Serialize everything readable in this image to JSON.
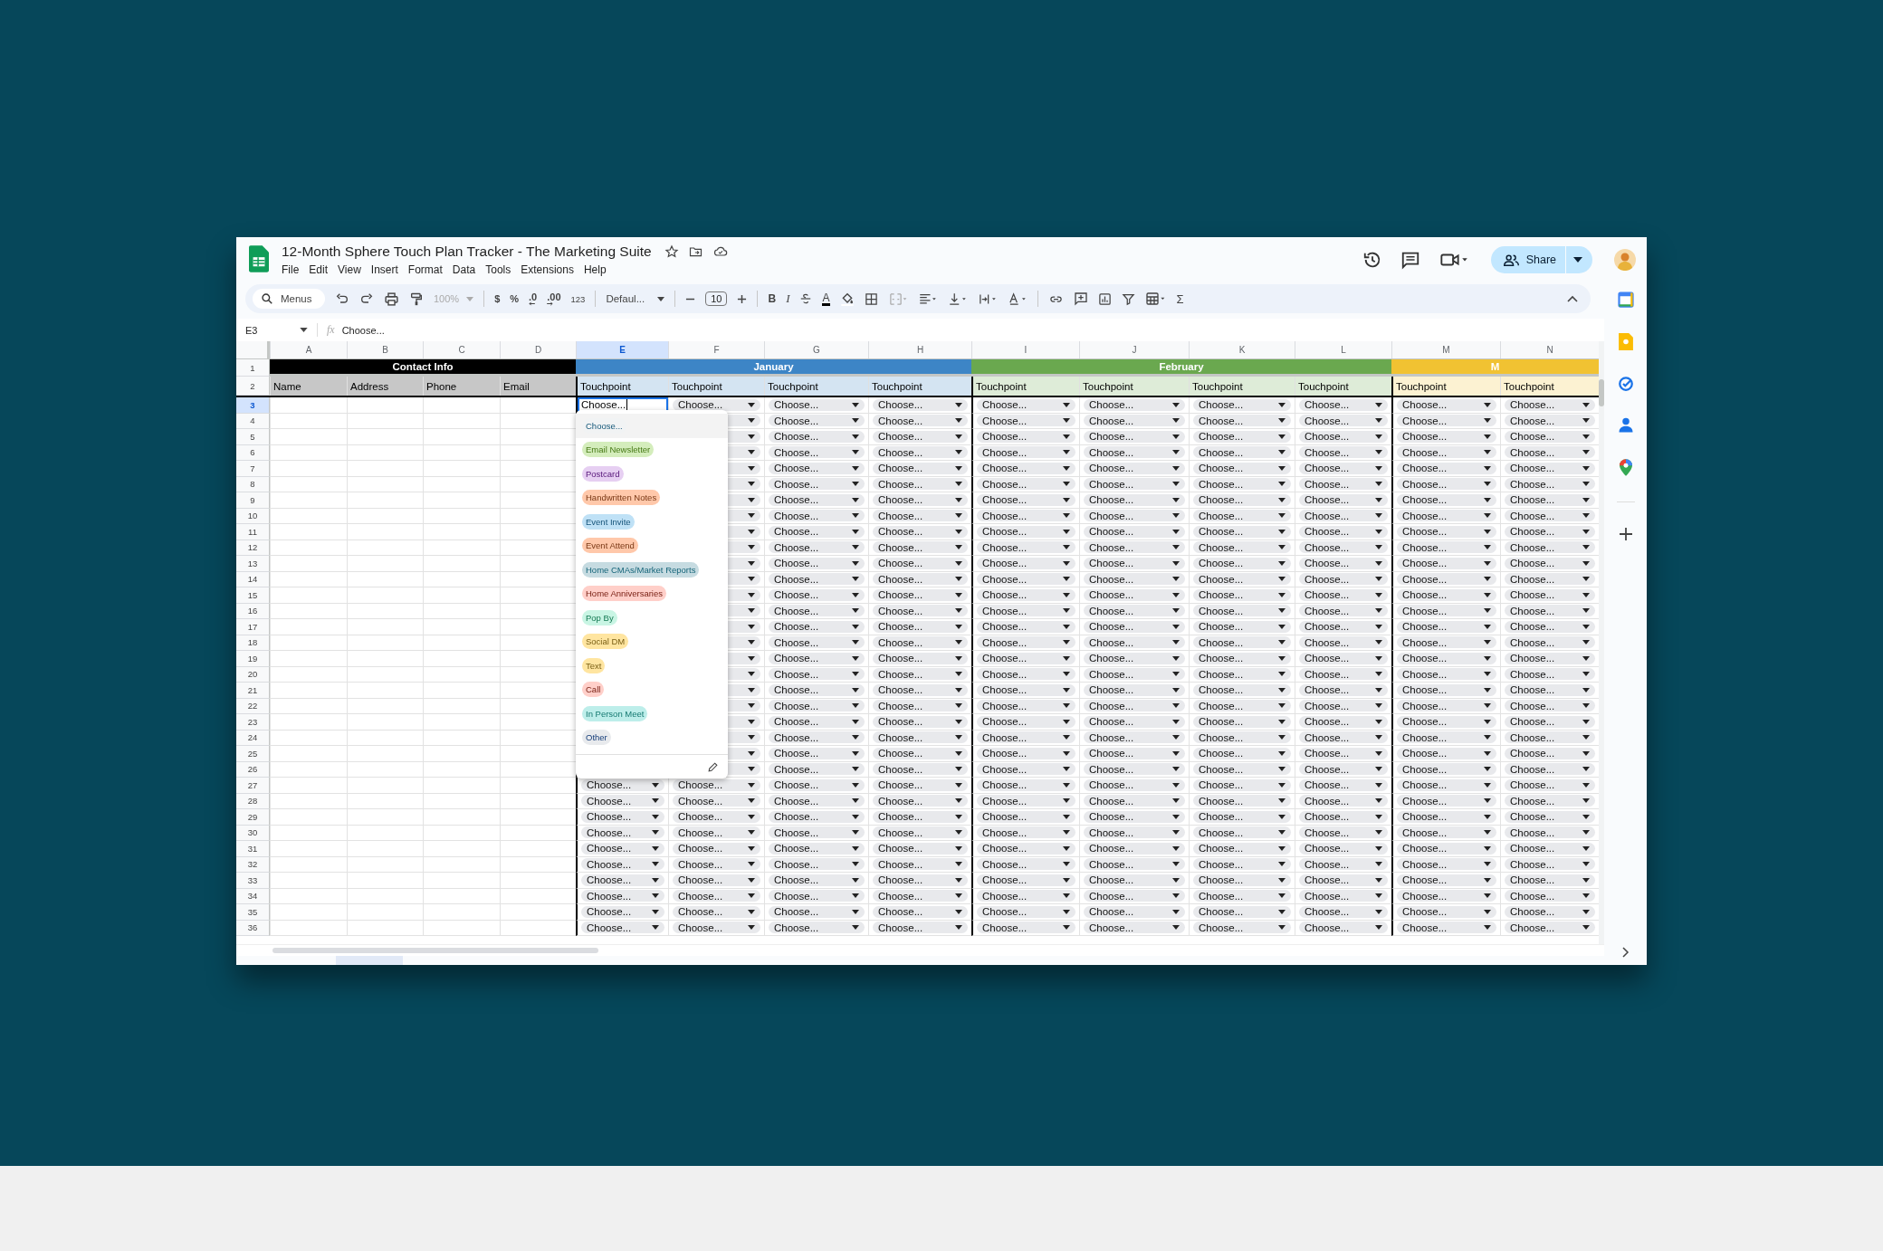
{
  "window": {
    "title": "12-Month Sphere Touch Plan Tracker - The Marketing Suite"
  },
  "menu_bar": [
    "File",
    "Edit",
    "View",
    "Insert",
    "Format",
    "Data",
    "Tools",
    "Extensions",
    "Help"
  ],
  "toolbar": {
    "search_placeholder": "Menus",
    "zoom": "100%",
    "currency": "$",
    "percent": "%",
    "decrease_decimals": ".0",
    "increase_decimals": ".00",
    "number_format": "123",
    "font": "Defaul...",
    "font_size": "10",
    "bold": "B",
    "italic": "I",
    "text_color": "A",
    "functions": "Σ"
  },
  "share_button": {
    "label": "Share"
  },
  "formula_bar": {
    "cell_ref": "E3",
    "fx": "fx",
    "value": "Choose..."
  },
  "columns": [
    {
      "letter": "A",
      "selected": false
    },
    {
      "letter": "B",
      "selected": false
    },
    {
      "letter": "C",
      "selected": false
    },
    {
      "letter": "D",
      "selected": false
    },
    {
      "letter": "E",
      "selected": true
    },
    {
      "letter": "F",
      "selected": false
    },
    {
      "letter": "G",
      "selected": false
    },
    {
      "letter": "H",
      "selected": false
    },
    {
      "letter": "I",
      "selected": false
    },
    {
      "letter": "J",
      "selected": false
    },
    {
      "letter": "K",
      "selected": false
    },
    {
      "letter": "L",
      "selected": false
    },
    {
      "letter": "M",
      "selected": false
    },
    {
      "letter": "N",
      "selected": false
    }
  ],
  "group_row": {
    "number": "1",
    "groups": [
      {
        "label": "Contact Info",
        "color": "#000000",
        "fields": [
          "Name",
          "Address",
          "Phone",
          "Email"
        ]
      },
      {
        "label": "January",
        "color": "#3d85c6",
        "fields": [
          "Touchpoint",
          "Touchpoint",
          "Touchpoint",
          "Touchpoint"
        ]
      },
      {
        "label": "February",
        "color": "#6aa84f",
        "fields": [
          "Touchpoint",
          "Touchpoint",
          "Touchpoint",
          "Touchpoint"
        ]
      },
      {
        "label": "M",
        "color": "#f1c232",
        "fields": [
          "Touchpoint",
          "Touchpoint"
        ]
      }
    ]
  },
  "field_row": {
    "number": "2"
  },
  "rows": [
    {
      "number": "3",
      "selected": true,
      "cells": [
        "Choose...",
        "Choose...",
        "Choose...",
        "Choose...",
        "Choose...",
        "Choose...",
        "Choose...",
        "Choose...",
        "Choose...",
        "Choose..."
      ]
    },
    {
      "number": "4",
      "selected": false,
      "cells": [
        null,
        null,
        "Choose...",
        "Choose...",
        "Choose...",
        "Choose...",
        "Choose...",
        "Choose...",
        "Choose...",
        "Choose..."
      ]
    },
    {
      "number": "5",
      "selected": false,
      "cells": [
        null,
        null,
        "Choose...",
        "Choose...",
        "Choose...",
        "Choose...",
        "Choose...",
        "Choose...",
        "Choose...",
        "Choose..."
      ]
    },
    {
      "number": "6",
      "selected": false,
      "cells": [
        null,
        null,
        "Choose...",
        "Choose...",
        "Choose...",
        "Choose...",
        "Choose...",
        "Choose...",
        "Choose...",
        "Choose..."
      ]
    },
    {
      "number": "7",
      "selected": false,
      "cells": [
        null,
        null,
        "Choose...",
        "Choose...",
        "Choose...",
        "Choose...",
        "Choose...",
        "Choose...",
        "Choose...",
        "Choose..."
      ]
    },
    {
      "number": "8",
      "selected": false,
      "cells": [
        null,
        null,
        "Choose...",
        "Choose...",
        "Choose...",
        "Choose...",
        "Choose...",
        "Choose...",
        "Choose...",
        "Choose..."
      ]
    },
    {
      "number": "9",
      "selected": false,
      "cells": [
        null,
        null,
        "Choose...",
        "Choose...",
        "Choose...",
        "Choose...",
        "Choose...",
        "Choose...",
        "Choose...",
        "Choose..."
      ]
    },
    {
      "number": "10",
      "selected": false,
      "cells": [
        null,
        null,
        "Choose...",
        "Choose...",
        "Choose...",
        "Choose...",
        "Choose...",
        "Choose...",
        "Choose...",
        "Choose..."
      ]
    },
    {
      "number": "11",
      "selected": false,
      "cells": [
        null,
        null,
        "Choose...",
        "Choose...",
        "Choose...",
        "Choose...",
        "Choose...",
        "Choose...",
        "Choose...",
        "Choose..."
      ]
    },
    {
      "number": "12",
      "selected": false,
      "cells": [
        null,
        null,
        "Choose...",
        "Choose...",
        "Choose...",
        "Choose...",
        "Choose...",
        "Choose...",
        "Choose...",
        "Choose..."
      ]
    },
    {
      "number": "13",
      "selected": false,
      "cells": [
        null,
        null,
        "Choose...",
        "Choose...",
        "Choose...",
        "Choose...",
        "Choose...",
        "Choose...",
        "Choose...",
        "Choose..."
      ]
    },
    {
      "number": "14",
      "selected": false,
      "cells": [
        null,
        null,
        "Choose...",
        "Choose...",
        "Choose...",
        "Choose...",
        "Choose...",
        "Choose...",
        "Choose...",
        "Choose..."
      ]
    },
    {
      "number": "15",
      "selected": false,
      "cells": [
        null,
        null,
        "Choose...",
        "Choose...",
        "Choose...",
        "Choose...",
        "Choose...",
        "Choose...",
        "Choose...",
        "Choose..."
      ]
    },
    {
      "number": "16",
      "selected": false,
      "cells": [
        null,
        null,
        "Choose...",
        "Choose...",
        "Choose...",
        "Choose...",
        "Choose...",
        "Choose...",
        "Choose...",
        "Choose..."
      ]
    },
    {
      "number": "17",
      "selected": false,
      "cells": [
        null,
        null,
        "Choose...",
        "Choose...",
        "Choose...",
        "Choose...",
        "Choose...",
        "Choose...",
        "Choose...",
        "Choose..."
      ]
    },
    {
      "number": "18",
      "selected": false,
      "cells": [
        null,
        null,
        "Choose...",
        "Choose...",
        "Choose...",
        "Choose...",
        "Choose...",
        "Choose...",
        "Choose...",
        "Choose..."
      ]
    },
    {
      "number": "19",
      "selected": false,
      "cells": [
        null,
        null,
        "Choose...",
        "Choose...",
        "Choose...",
        "Choose...",
        "Choose...",
        "Choose...",
        "Choose...",
        "Choose..."
      ]
    },
    {
      "number": "20",
      "selected": false,
      "cells": [
        null,
        null,
        "Choose...",
        "Choose...",
        "Choose...",
        "Choose...",
        "Choose...",
        "Choose...",
        "Choose...",
        "Choose..."
      ]
    },
    {
      "number": "21",
      "selected": false,
      "cells": [
        null,
        null,
        "Choose...",
        "Choose...",
        "Choose...",
        "Choose...",
        "Choose...",
        "Choose...",
        "Choose...",
        "Choose..."
      ]
    },
    {
      "number": "22",
      "selected": false,
      "cells": [
        null,
        null,
        "Choose...",
        "Choose...",
        "Choose...",
        "Choose...",
        "Choose...",
        "Choose...",
        "Choose...",
        "Choose..."
      ]
    },
    {
      "number": "23",
      "selected": false,
      "cells": [
        null,
        null,
        "Choose...",
        "Choose...",
        "Choose...",
        "Choose...",
        "Choose...",
        "Choose...",
        "Choose...",
        "Choose..."
      ]
    },
    {
      "number": "24",
      "selected": false,
      "cells": [
        null,
        null,
        "Choose...",
        "Choose...",
        "Choose...",
        "Choose...",
        "Choose...",
        "Choose...",
        "Choose...",
        "Choose..."
      ]
    },
    {
      "number": "25",
      "selected": false,
      "cells": [
        null,
        null,
        "Choose...",
        "Choose...",
        "Choose...",
        "Choose...",
        "Choose...",
        "Choose...",
        "Choose...",
        "Choose..."
      ]
    },
    {
      "number": "26",
      "selected": false,
      "cells": [
        null,
        null,
        "Choose...",
        "Choose...",
        "Choose...",
        "Choose...",
        "Choose...",
        "Choose...",
        "Choose...",
        "Choose..."
      ]
    },
    {
      "number": "27",
      "selected": false,
      "cells": [
        "Choose...",
        "Choose...",
        "Choose...",
        "Choose...",
        "Choose...",
        "Choose...",
        "Choose...",
        "Choose...",
        "Choose...",
        "Choose..."
      ]
    },
    {
      "number": "28",
      "selected": false,
      "cells": [
        "Choose...",
        "Choose...",
        "Choose...",
        "Choose...",
        "Choose...",
        "Choose...",
        "Choose...",
        "Choose...",
        "Choose...",
        "Choose..."
      ]
    },
    {
      "number": "29",
      "selected": false,
      "cells": [
        "Choose...",
        "Choose...",
        "Choose...",
        "Choose...",
        "Choose...",
        "Choose...",
        "Choose...",
        "Choose...",
        "Choose...",
        "Choose..."
      ]
    },
    {
      "number": "30",
      "selected": false,
      "cells": [
        "Choose...",
        "Choose...",
        "Choose...",
        "Choose...",
        "Choose...",
        "Choose...",
        "Choose...",
        "Choose...",
        "Choose...",
        "Choose..."
      ]
    },
    {
      "number": "31",
      "selected": false,
      "cells": [
        "Choose...",
        "Choose...",
        "Choose...",
        "Choose...",
        "Choose...",
        "Choose...",
        "Choose...",
        "Choose...",
        "Choose...",
        "Choose..."
      ]
    },
    {
      "number": "32",
      "selected": false,
      "cells": [
        "Choose...",
        "Choose...",
        "Choose...",
        "Choose...",
        "Choose...",
        "Choose...",
        "Choose...",
        "Choose...",
        "Choose...",
        "Choose..."
      ]
    },
    {
      "number": "33",
      "selected": false,
      "cells": [
        "Choose...",
        "Choose...",
        "Choose...",
        "Choose...",
        "Choose...",
        "Choose...",
        "Choose...",
        "Choose...",
        "Choose...",
        "Choose..."
      ]
    },
    {
      "number": "34",
      "selected": false,
      "cells": [
        "Choose...",
        "Choose...",
        "Choose...",
        "Choose...",
        "Choose...",
        "Choose...",
        "Choose...",
        "Choose...",
        "Choose...",
        "Choose..."
      ]
    },
    {
      "number": "35",
      "selected": false,
      "cells": [
        "Choose...",
        "Choose...",
        "Choose...",
        "Choose...",
        "Choose...",
        "Choose...",
        "Choose...",
        "Choose...",
        "Choose...",
        "Choose..."
      ]
    },
    {
      "number": "36",
      "selected": false,
      "cells": [
        "Choose...",
        "Choose...",
        "Choose...",
        "Choose...",
        "Choose...",
        "Choose...",
        "Choose...",
        "Choose...",
        "Choose...",
        "Choose..."
      ]
    }
  ],
  "dropdown": {
    "options": [
      {
        "label": "Choose...",
        "color": "#f1f3f4"
      },
      {
        "label": "Email Newsletter",
        "color": "#d4edbc"
      },
      {
        "label": "Postcard",
        "color": "#e6cff2"
      },
      {
        "label": "Handwritten Notes",
        "color": "#ffc8aa"
      },
      {
        "label": "Event Invite",
        "color": "#bfe1f6"
      },
      {
        "label": "Event Attend",
        "color": "#ffc8aa"
      },
      {
        "label": "Home CMAs/Market Reports",
        "color": "#c6dbe1"
      },
      {
        "label": "Home Anniversaries",
        "color": "#ffcfc9"
      },
      {
        "label": "Pop By",
        "color": "#c9f5e4"
      },
      {
        "label": "Social DM",
        "color": "#ffe5a0"
      },
      {
        "label": "Text",
        "color": "#ffe5a0"
      },
      {
        "label": "Call",
        "color": "#ffcfc9"
      },
      {
        "label": "In Person Meet",
        "color": "#bdeeea"
      },
      {
        "label": "Other",
        "color": "#e8eaed"
      }
    ]
  }
}
